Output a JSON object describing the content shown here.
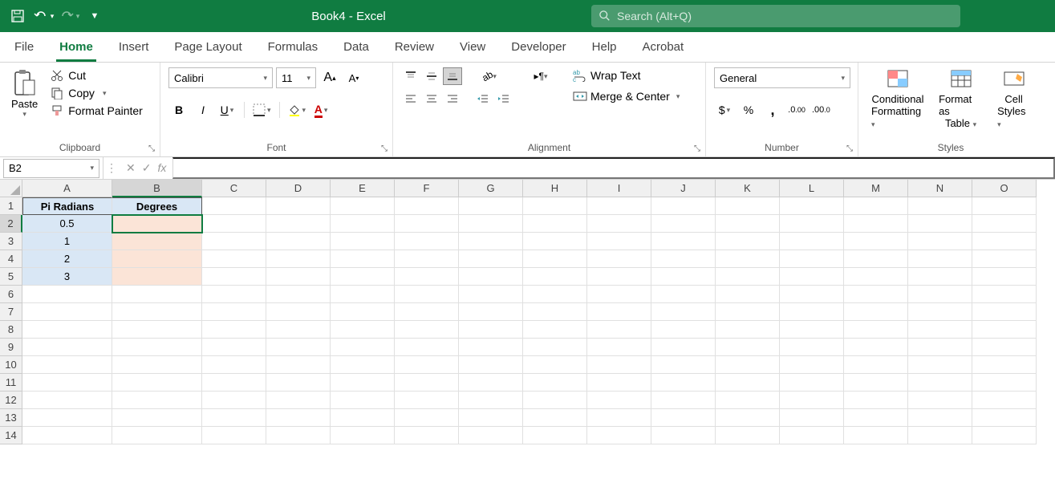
{
  "title": "Book4  -  Excel",
  "search": {
    "placeholder": "Search (Alt+Q)"
  },
  "tabs": [
    "File",
    "Home",
    "Insert",
    "Page Layout",
    "Formulas",
    "Data",
    "Review",
    "View",
    "Developer",
    "Help",
    "Acrobat"
  ],
  "activeTab": "Home",
  "clipboard": {
    "paste": "Paste",
    "cut": "Cut",
    "copy": "Copy",
    "formatPainter": "Format Painter",
    "label": "Clipboard"
  },
  "font": {
    "name": "Calibri",
    "size": "11",
    "label": "Font"
  },
  "alignment": {
    "wrap": "Wrap Text",
    "merge": "Merge & Center",
    "label": "Alignment"
  },
  "number": {
    "format": "General",
    "label": "Number"
  },
  "styles": {
    "cond": "Conditional",
    "cond2": "Formatting",
    "fmt": "Format as",
    "fmt2": "Table",
    "cell": "Cell",
    "cell2": "Styles",
    "label": "Styles"
  },
  "namebox": "B2",
  "formula": "",
  "cols": [
    "A",
    "B",
    "C",
    "D",
    "E",
    "F",
    "G",
    "H",
    "I",
    "J",
    "K",
    "L",
    "M",
    "N",
    "O"
  ],
  "rows": [
    1,
    2,
    3,
    4,
    5,
    6,
    7,
    8,
    9,
    10,
    11,
    12,
    13,
    14
  ],
  "sheet": {
    "A1": "Pi Radians",
    "B1": "Degrees",
    "A2": "0.5",
    "A3": "1",
    "A4": "2",
    "A5": "3"
  }
}
